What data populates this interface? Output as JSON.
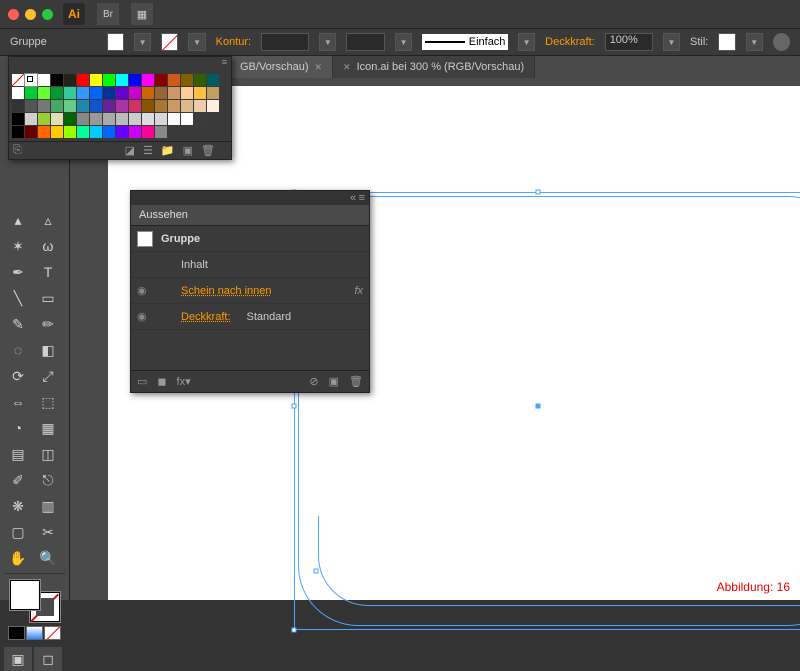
{
  "titlebar": {
    "ai": "Ai",
    "br": "Br"
  },
  "control": {
    "selection": "Gruppe",
    "kontur": "Kontur:",
    "stroke_style": "Einfach",
    "deckkraft": "Deckkraft:",
    "deckkraft_val": "100%",
    "stil": "Stil:"
  },
  "tabs": [
    {
      "label": "GB/Vorschau)"
    },
    {
      "label": "Icon.ai bei 300 % (RGB/Vorschau)"
    }
  ],
  "swatches": {
    "rows": [
      [
        "none",
        "reg",
        "#fff",
        "#000",
        "#26211b",
        "#ff0000",
        "#ffff00",
        "#00ff00",
        "#00ffff",
        "#0000ff",
        "#ff00ff",
        "#8b0000",
        "#cd5c1c",
        "#806000",
        "#355e00",
        "#005e5e"
      ],
      [
        "#ffffff",
        "#00cc33",
        "#66ff33",
        "#009933",
        "#33cc99",
        "#3399ff",
        "#0066ff",
        "#003399",
        "#6600cc",
        "#cc00cc",
        "#cc6600",
        "#996633",
        "#cc9966",
        "#ffcc99",
        "#ffc040",
        "#c0a060"
      ],
      [
        "#333333",
        "#555555",
        "#777777",
        "#4a6",
        "#6c8",
        "#28a",
        "#15c",
        "#629",
        "#a3a",
        "#c36",
        "#850",
        "#a73",
        "#c96",
        "#db8",
        "#eca",
        "#fed"
      ],
      [
        "#000",
        "#d0d0d0",
        "#9acd32",
        "#e0e0b0",
        "#006400",
        "#888",
        "#999",
        "#aaa",
        "#bbb",
        "#ccc",
        "#ddd",
        "#d8d8d8",
        "#fafafa",
        "#fff",
        "#3b3b3b",
        ""
      ],
      [
        "#000",
        "#660000",
        "#ff6600",
        "#ffcc00",
        "#99ff00",
        "#00ff99",
        "#00ccff",
        "#0066ff",
        "#6600ff",
        "#cc00ff",
        "#ff0099",
        "#888",
        "",
        "",
        "",
        ""
      ]
    ]
  },
  "appearance": {
    "title": "Aussehen",
    "group": "Gruppe",
    "inhalt": "Inhalt",
    "schein": "Schein nach innen",
    "deckkraft": "Deckkraft:",
    "standard": "Standard",
    "fx": "fx"
  },
  "caption": "Abbildung: 16"
}
